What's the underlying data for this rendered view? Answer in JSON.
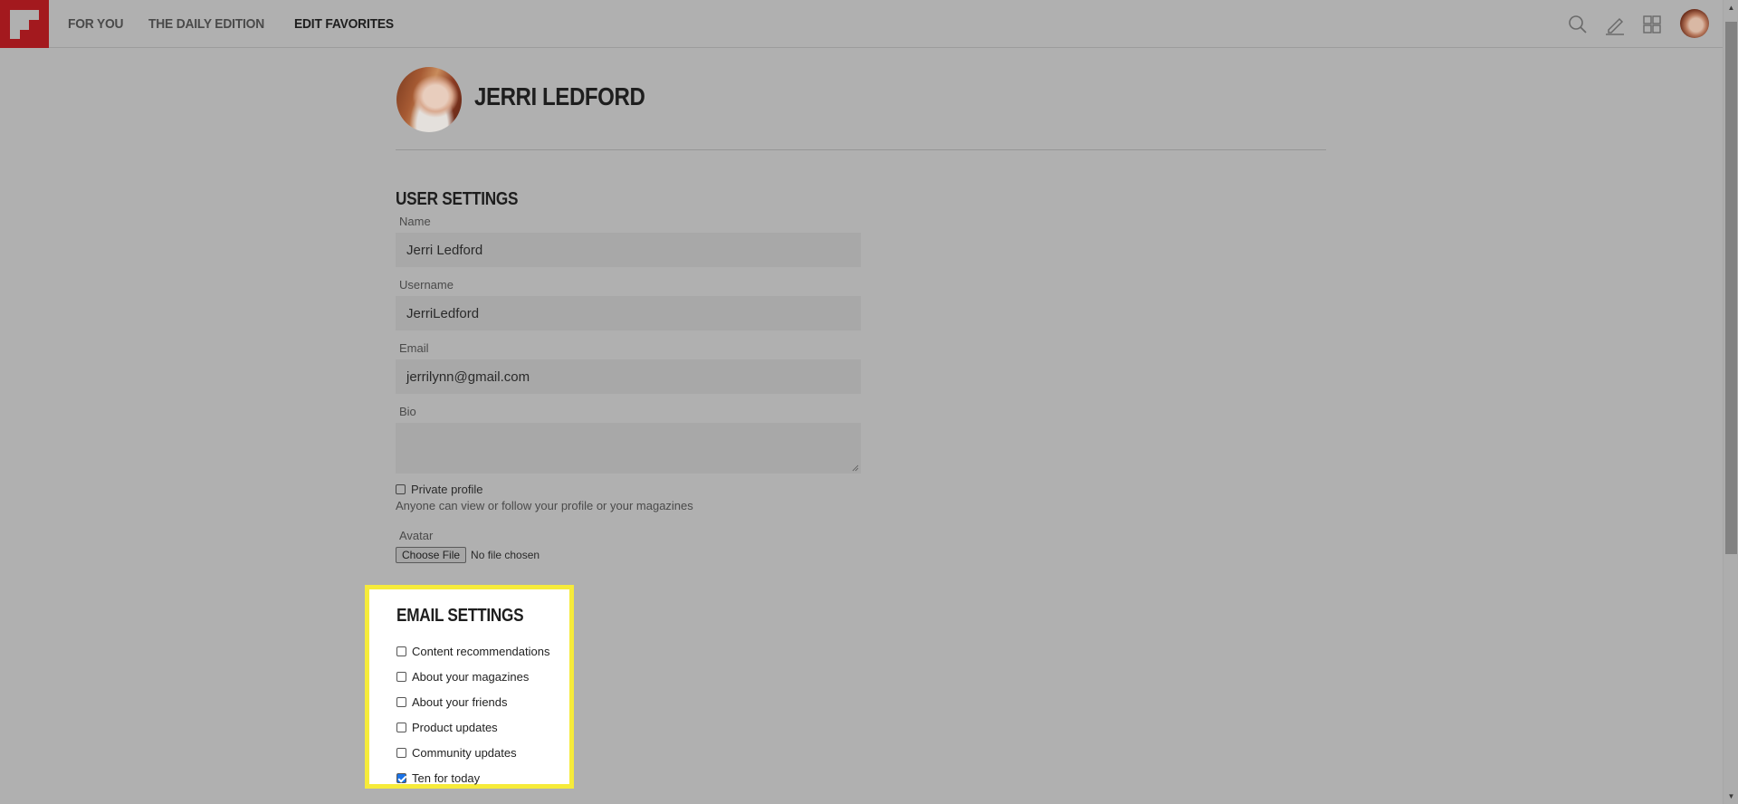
{
  "nav": {
    "logo_label": "Flipboard",
    "items": [
      {
        "label": "FOR YOU",
        "active": false
      },
      {
        "label": "THE DAILY EDITION",
        "active": false
      },
      {
        "label": "EDIT FAVORITES",
        "active": true
      }
    ],
    "icons": [
      "search-icon",
      "pencil-icon",
      "grid-icon",
      "avatar"
    ]
  },
  "profile": {
    "name": "JERRI LEDFORD"
  },
  "user_settings": {
    "title": "USER SETTINGS",
    "name_label": "Name",
    "name_value": "Jerri Ledford",
    "username_label": "Username",
    "username_value": "JerriLedford",
    "email_label": "Email",
    "email_value": "jerrilynn@gmail.com",
    "bio_label": "Bio",
    "bio_value": "",
    "private_profile_label": "Private profile",
    "private_profile_checked": false,
    "private_hint": "Anyone can view or follow your profile or your magazines",
    "avatar_label": "Avatar",
    "choose_file_label": "Choose File",
    "no_file_label": "No file chosen"
  },
  "email_settings": {
    "title": "EMAIL SETTINGS",
    "highlight_color": "#f6eb3a",
    "items": [
      {
        "label": "Content recommendations",
        "checked": false
      },
      {
        "label": "About your magazines",
        "checked": false
      },
      {
        "label": "About your friends",
        "checked": false
      },
      {
        "label": "Product updates",
        "checked": false
      },
      {
        "label": "Community updates",
        "checked": false
      },
      {
        "label": "Ten for today",
        "checked": true
      }
    ]
  },
  "colors": {
    "brand_red": "#a3191e",
    "checkbox_checked": "#1a73e8",
    "overlay_bg": "#b0b0b0"
  }
}
